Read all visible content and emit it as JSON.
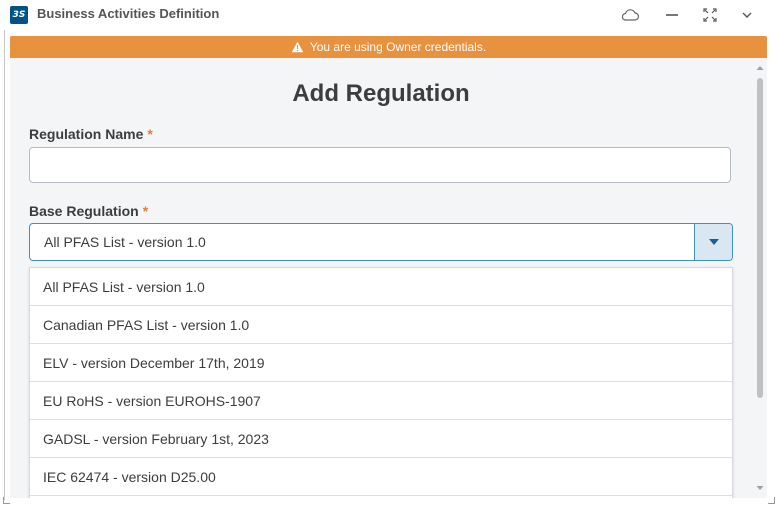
{
  "window": {
    "title": "Business Activities Definition",
    "logo_text": "3S",
    "brand_color": "#005386"
  },
  "banner": {
    "text": "You are using Owner credentials.",
    "color": "#e8913f",
    "icon": "warning-icon"
  },
  "form": {
    "title": "Add Regulation",
    "regulation_name": {
      "label": "Regulation Name",
      "required_mark": "*",
      "value": "",
      "placeholder": ""
    },
    "base_regulation": {
      "label": "Base Regulation",
      "required_mark": "*",
      "selected": "All PFAS List - version 1.0",
      "options": [
        "All PFAS List - version 1.0",
        "Canadian PFAS List - version 1.0",
        "ELV - version December 17th, 2019",
        "EU RoHS - version EUROHS-1907",
        "GADSL - version February 1st, 2023",
        "IEC 62474 - version D25.00"
      ]
    }
  },
  "colors": {
    "accent_border": "#3f8fc4",
    "select_button_bg": "#d9e7f3",
    "required": "#e87b2f"
  }
}
